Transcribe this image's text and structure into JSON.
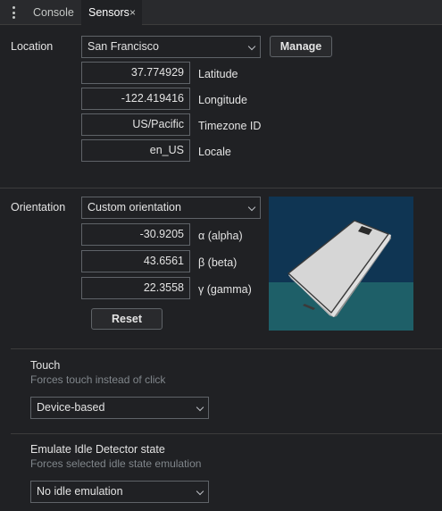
{
  "tabs": [
    {
      "label": "Console"
    },
    {
      "label": "Sensors"
    }
  ],
  "tab_close_glyph": "×",
  "location": {
    "label": "Location",
    "selected": "San Francisco",
    "manage_label": "Manage",
    "latitude": {
      "value": "37.774929",
      "label": "Latitude"
    },
    "longitude": {
      "value": "-122.419416",
      "label": "Longitude"
    },
    "timezone": {
      "value": "US/Pacific",
      "label": "Timezone ID"
    },
    "locale": {
      "value": "en_US",
      "label": "Locale"
    }
  },
  "orientation": {
    "label": "Orientation",
    "selected": "Custom orientation",
    "alpha": {
      "value": "-30.9205",
      "label": "α (alpha)"
    },
    "beta": {
      "value": "43.6561",
      "label": "β (beta)"
    },
    "gamma": {
      "value": "22.3558",
      "label": "γ (gamma)"
    },
    "reset_label": "Reset",
    "preview_colors": {
      "sky": "#0f3553",
      "ground": "#1e5f68",
      "device": "#d6d6d6"
    }
  },
  "touch": {
    "title": "Touch",
    "hint": "Forces touch instead of click",
    "selected": "Device-based"
  },
  "idle": {
    "title": "Emulate Idle Detector state",
    "hint": "Forces selected idle state emulation",
    "selected": "No idle emulation"
  },
  "icons": {
    "menu": "kebab-menu-icon",
    "close": "close-icon",
    "dropdown": "chevron-down-icon",
    "device": "phone-icon"
  },
  "colors": {
    "background": "#202124",
    "tabbar": "#292a2d",
    "border": "#5f6368",
    "hint_text": "#80868b"
  }
}
